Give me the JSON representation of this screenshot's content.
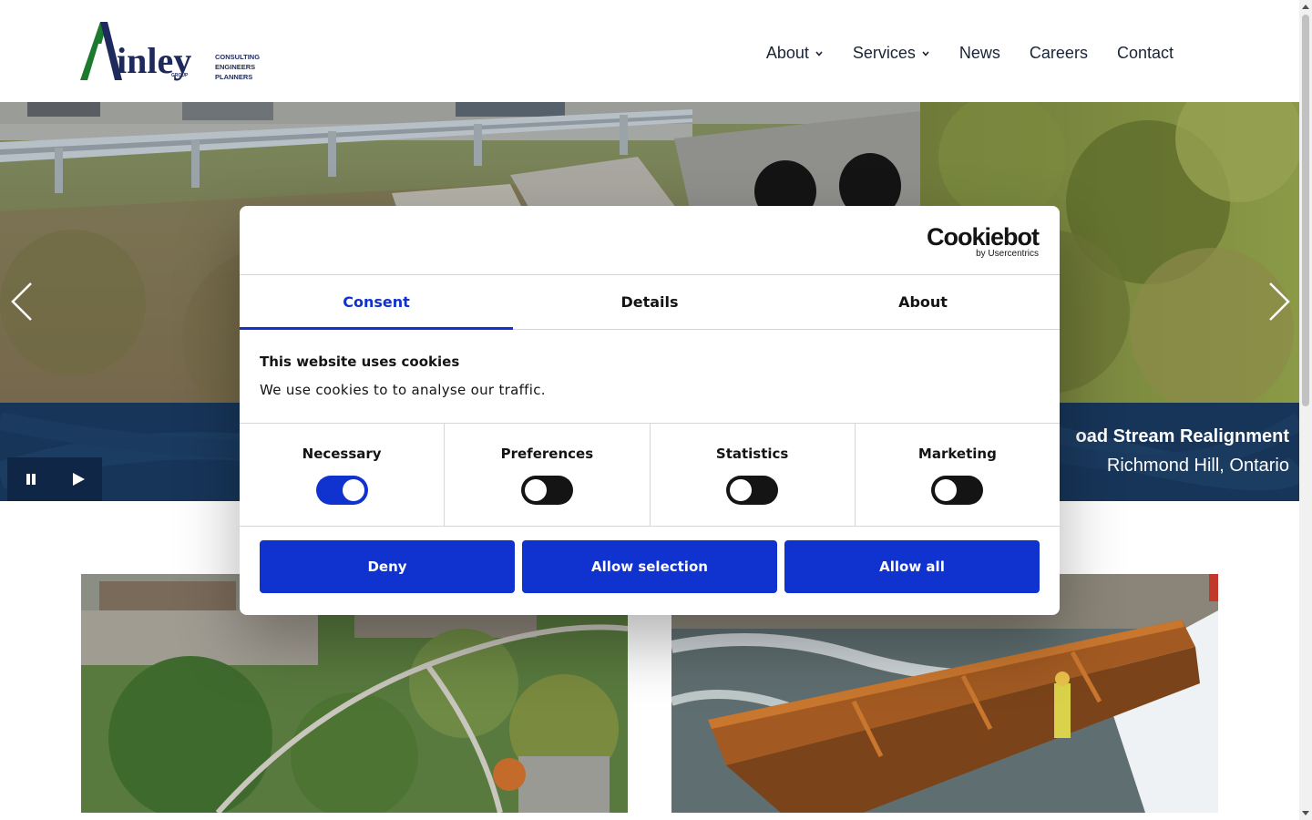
{
  "header": {
    "logo_text": "inley",
    "logo_tagline": [
      "CONSULTING",
      "ENGINEERS",
      "PLANNERS"
    ],
    "logo_group": "GROUP",
    "nav": [
      {
        "label": "About",
        "has_dropdown": true
      },
      {
        "label": "Services",
        "has_dropdown": true
      },
      {
        "label": "News",
        "has_dropdown": false
      },
      {
        "label": "Careers",
        "has_dropdown": false
      },
      {
        "label": "Contact",
        "has_dropdown": false
      }
    ]
  },
  "hero": {
    "caption_title": "oad Stream Realignment",
    "caption_location": "Richmond Hill, Ontario",
    "band_color": "#173559"
  },
  "cookie_dialog": {
    "brand": "Cookiebot",
    "brand_sub": "by Usercentrics",
    "tabs": [
      {
        "label": "Consent",
        "active": true
      },
      {
        "label": "Details",
        "active": false
      },
      {
        "label": "About",
        "active": false
      }
    ],
    "title": "This website uses cookies",
    "text": "We use cookies to to analyse our traffic.",
    "categories": [
      {
        "label": "Necessary",
        "enabled": true
      },
      {
        "label": "Preferences",
        "enabled": false
      },
      {
        "label": "Statistics",
        "enabled": false
      },
      {
        "label": "Marketing",
        "enabled": false
      }
    ],
    "buttons": {
      "deny": "Deny",
      "allow_selection": "Allow selection",
      "allow_all": "Allow all"
    },
    "accent_color": "#1032cf"
  }
}
